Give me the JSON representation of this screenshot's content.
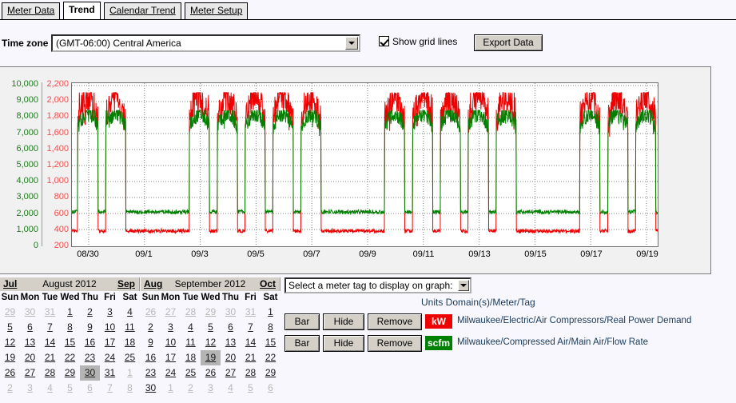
{
  "tabs": [
    {
      "label": "Meter Data",
      "active": false
    },
    {
      "label": "Trend",
      "active": true
    },
    {
      "label": "Calendar Trend",
      "active": false
    },
    {
      "label": "Meter Setup",
      "active": false
    }
  ],
  "toolbar": {
    "timezone_label": "Time zone",
    "timezone_value": "(GMT-06:00) Central America",
    "show_grid_label": "Show grid lines",
    "show_grid_checked": true,
    "export_label": "Export Data"
  },
  "tag_select": {
    "value": "Select a meter tag to display on graph:"
  },
  "legend": {
    "header": "Units Domain(s)/Meter/Tag",
    "rows": [
      {
        "bar_label": "Bar",
        "hide_label": "Hide",
        "remove_label": "Remove",
        "units": "kW",
        "color": "#ee0000",
        "path": "Milwaukee/Electric/Air Compressors/Real Power Demand"
      },
      {
        "bar_label": "Bar",
        "hide_label": "Hide",
        "remove_label": "Remove",
        "units": "scfm",
        "color": "#008000",
        "path": "Milwaukee/Compressed Air/Main Air/Flow Rate"
      }
    ]
  },
  "calendars": [
    {
      "prev": "Jul",
      "title": "August 2012",
      "next": "Sep",
      "dow": [
        "Sun",
        "Mon",
        "Tue",
        "Wed",
        "Thu",
        "Fri",
        "Sat"
      ],
      "weeks": [
        [
          {
            "d": "29",
            "dim": true
          },
          {
            "d": "30",
            "dim": true
          },
          {
            "d": "31",
            "dim": true
          },
          {
            "d": "1"
          },
          {
            "d": "2"
          },
          {
            "d": "3"
          },
          {
            "d": "4"
          }
        ],
        [
          {
            "d": "5"
          },
          {
            "d": "6"
          },
          {
            "d": "7"
          },
          {
            "d": "8"
          },
          {
            "d": "9"
          },
          {
            "d": "10"
          },
          {
            "d": "11"
          }
        ],
        [
          {
            "d": "12"
          },
          {
            "d": "13"
          },
          {
            "d": "14"
          },
          {
            "d": "15"
          },
          {
            "d": "16"
          },
          {
            "d": "17"
          },
          {
            "d": "18"
          }
        ],
        [
          {
            "d": "19"
          },
          {
            "d": "20"
          },
          {
            "d": "21"
          },
          {
            "d": "22"
          },
          {
            "d": "23"
          },
          {
            "d": "24"
          },
          {
            "d": "25"
          }
        ],
        [
          {
            "d": "26"
          },
          {
            "d": "27"
          },
          {
            "d": "28"
          },
          {
            "d": "29"
          },
          {
            "d": "30",
            "sel": true
          },
          {
            "d": "31"
          },
          {
            "d": "1",
            "dim": true
          }
        ],
        [
          {
            "d": "2",
            "dim": true
          },
          {
            "d": "3",
            "dim": true
          },
          {
            "d": "4",
            "dim": true
          },
          {
            "d": "5",
            "dim": true
          },
          {
            "d": "6",
            "dim": true
          },
          {
            "d": "7",
            "dim": true
          },
          {
            "d": "8",
            "dim": true
          }
        ]
      ]
    },
    {
      "prev": "Aug",
      "title": "September 2012",
      "next": "Oct",
      "dow": [
        "Sun",
        "Mon",
        "Tue",
        "Wed",
        "Thu",
        "Fri",
        "Sat"
      ],
      "weeks": [
        [
          {
            "d": "26",
            "dim": true
          },
          {
            "d": "27",
            "dim": true
          },
          {
            "d": "28",
            "dim": true
          },
          {
            "d": "29",
            "dim": true
          },
          {
            "d": "30",
            "dim": true
          },
          {
            "d": "31",
            "dim": true
          },
          {
            "d": "1"
          }
        ],
        [
          {
            "d": "2"
          },
          {
            "d": "3"
          },
          {
            "d": "4"
          },
          {
            "d": "5"
          },
          {
            "d": "6"
          },
          {
            "d": "7"
          },
          {
            "d": "8"
          }
        ],
        [
          {
            "d": "9"
          },
          {
            "d": "10"
          },
          {
            "d": "11"
          },
          {
            "d": "12"
          },
          {
            "d": "13"
          },
          {
            "d": "14"
          },
          {
            "d": "15"
          }
        ],
        [
          {
            "d": "16"
          },
          {
            "d": "17"
          },
          {
            "d": "18"
          },
          {
            "d": "19",
            "sel": true
          },
          {
            "d": "20"
          },
          {
            "d": "21"
          },
          {
            "d": "22"
          }
        ],
        [
          {
            "d": "23"
          },
          {
            "d": "24"
          },
          {
            "d": "25"
          },
          {
            "d": "26"
          },
          {
            "d": "27"
          },
          {
            "d": "28"
          },
          {
            "d": "29"
          }
        ],
        [
          {
            "d": "30"
          },
          {
            "d": "1",
            "dim": true
          },
          {
            "d": "2",
            "dim": true
          },
          {
            "d": "3",
            "dim": true
          },
          {
            "d": "4",
            "dim": true
          },
          {
            "d": "5",
            "dim": true
          },
          {
            "d": "6",
            "dim": true
          }
        ]
      ]
    }
  ],
  "chart_data": {
    "type": "line",
    "title": "",
    "xlabel": "",
    "grid": true,
    "legend_position": "below-right",
    "x_ticks": [
      "08/30",
      "09/1",
      "09/3",
      "09/5",
      "09/7",
      "09/9",
      "09/11",
      "09/13",
      "09/15",
      "09/17",
      "09/19"
    ],
    "x_range": [
      "08/30",
      "09/20"
    ],
    "axes": [
      {
        "name": "left-green",
        "units": "scfm",
        "color": "#008000",
        "ylim": [
          0,
          10000
        ],
        "ticks": [
          "0",
          "1,000",
          "2,000",
          "3,000",
          "4,000",
          "5,000",
          "6,000",
          "7,000",
          "8,000",
          "9,000",
          "10,000"
        ]
      },
      {
        "name": "left-red",
        "units": "kW",
        "color": "#f05050",
        "ylim": [
          200,
          2200
        ],
        "ticks": [
          "200",
          "400",
          "600",
          "800",
          "1,000",
          "1,200",
          "1,400",
          "1,600",
          "1,800",
          "2,000",
          "2,200"
        ]
      }
    ],
    "series": [
      {
        "name": "Milwaukee/Electric/Air Compressors/Real Power Demand",
        "units": "kW",
        "axis": "left-red",
        "color": "#ee0000",
        "description": "Weekday production peaks ~1500-2050 kW with heavy high-frequency noise; weekend/overnight baseline ~350-420 kW.",
        "weekday_peak": 2050,
        "weekday_typical": 1600,
        "weekend_base": 380,
        "values": [
          420,
          400,
          1450,
          1800,
          2050,
          1700,
          1900,
          1600,
          1750,
          1500,
          1650,
          430,
          390,
          400,
          380,
          1500,
          1850,
          2000,
          1750,
          1600,
          1700,
          1550,
          400,
          360,
          340,
          330,
          350,
          340,
          360,
          350,
          340,
          330,
          350,
          1500,
          1800,
          1950,
          1700,
          1600,
          1750,
          1550,
          1600,
          1500,
          390,
          370,
          360,
          350,
          370,
          360,
          350,
          340,
          360,
          1480,
          1820,
          1980,
          1680,
          1620,
          1700,
          1520,
          400,
          380,
          370,
          360,
          380,
          370,
          360,
          1500,
          1850,
          2000,
          1720,
          1640,
          1680,
          1540,
          410,
          390,
          380,
          370,
          390,
          380,
          370,
          1520,
          1880,
          2100,
          1750,
          1660,
          1720,
          1560,
          420,
          400,
          390,
          380,
          400,
          390,
          380
        ]
      },
      {
        "name": "Milwaukee/Compressed Air/Main Air/Flow Rate",
        "units": "scfm",
        "axis": "left-green",
        "color": "#008000",
        "description": "Tracks power closely; weekday peaks ~7000-8200 scfm, weekend/idle baseline ~1800-2400 scfm.",
        "weekday_peak": 8200,
        "weekday_typical": 7000,
        "weekend_base": 2100,
        "values": [
          2000,
          1950,
          6500,
          7500,
          8200,
          7200,
          7800,
          6900,
          7400,
          6600,
          7000,
          2050,
          1900,
          1950,
          1850,
          6600,
          7600,
          8000,
          7300,
          6900,
          7200,
          6700,
          2100,
          2300,
          2200,
          2400,
          2350,
          2250,
          2400,
          2300,
          2200,
          2100,
          2350,
          6500,
          7500,
          8100,
          7200,
          6900,
          7400,
          6700,
          6900,
          6500,
          2200,
          2400,
          2300,
          2250,
          2400,
          2350,
          2300,
          2200,
          2400,
          6400,
          7550,
          8050,
          7150,
          6950,
          7300,
          6600,
          2150,
          2350,
          2250,
          2200,
          2350,
          2300,
          2250,
          6550,
          7650,
          8150,
          7250,
          7000,
          7250,
          6650,
          2250,
          2450,
          2350,
          2300,
          2450,
          2400,
          2350,
          6600,
          7700,
          8250,
          7300,
          7050,
          7350,
          6700,
          2300,
          2500,
          2400,
          2350,
          2500,
          2450,
          2400
        ]
      }
    ]
  }
}
